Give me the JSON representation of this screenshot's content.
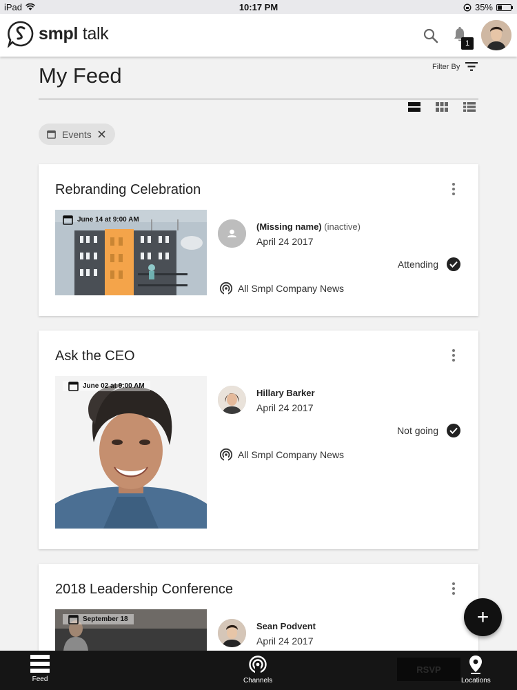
{
  "status_bar": {
    "device": "iPad",
    "time": "10:17 PM",
    "battery": "35%",
    "battery_level": 0.35
  },
  "app": {
    "logo_bold": "smpl",
    "logo_light": " talk",
    "notification_count": "1"
  },
  "header": {
    "title": "My Feed",
    "filter_label": "Filter By"
  },
  "filter_chip": {
    "label": "Events"
  },
  "cards": [
    {
      "title": "Rebranding Celebration",
      "image_date": "June 14 at 9:00 AM",
      "author": "(Missing name)",
      "author_status": "(inactive)",
      "date": "April 24 2017",
      "rsvp": "Attending",
      "channel": "All Smpl Company News"
    },
    {
      "title": "Ask the CEO",
      "image_date": "June 02 at 9:00 AM",
      "author": "Hillary Barker",
      "author_status": "",
      "date": "April 24 2017",
      "rsvp": "Not going",
      "channel": "All Smpl Company News"
    },
    {
      "title": "2018 Leadership Conference",
      "image_date": "September 18",
      "author": "Sean Podvent",
      "author_status": "",
      "date": "April 24 2017",
      "rsvp": "",
      "channel": ""
    }
  ],
  "bottom_nav": {
    "feed": "Feed",
    "channels": "Channels",
    "locations": "Locations",
    "rsvp_button": "RSVP"
  },
  "fab": {
    "label": "+"
  }
}
